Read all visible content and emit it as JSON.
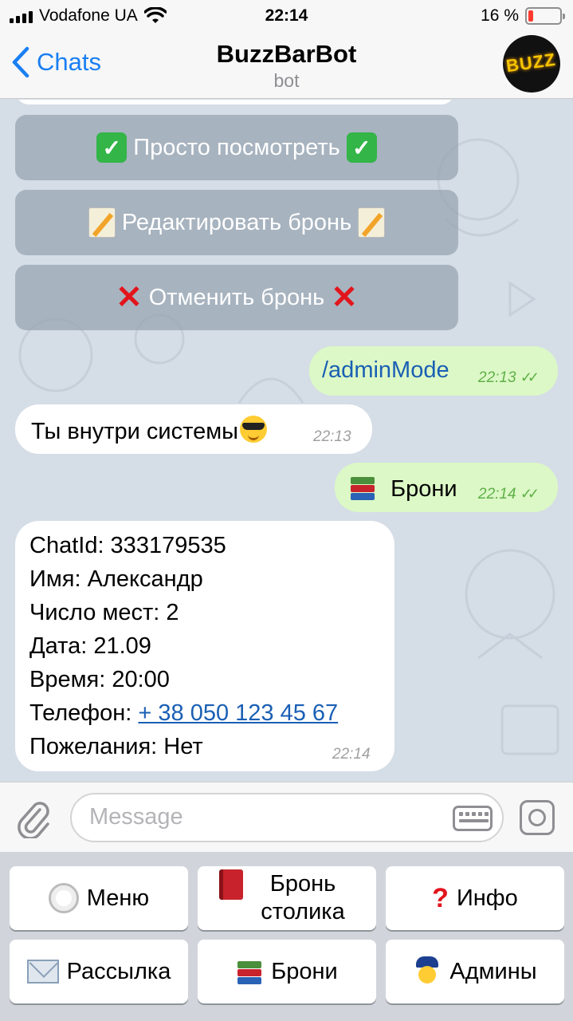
{
  "status_bar": {
    "carrier": "Vodafone UA",
    "time": "22:14",
    "battery": "16 %",
    "battery_level_fraction": 0.16
  },
  "nav": {
    "back_label": "Chats",
    "title": "BuzzBarBot",
    "subtitle": "bot",
    "avatar_text": "BUZZ"
  },
  "inline_buttons": [
    {
      "label": "Просто посмотреть",
      "icon": "check-mark-button-emoji"
    },
    {
      "label": "Редактировать бронь",
      "icon": "memo-emoji"
    },
    {
      "label": "Отменить бронь",
      "icon": "cross-mark-emoji"
    }
  ],
  "messages": [
    {
      "direction": "out",
      "text": "/adminMode",
      "time": "22:13",
      "status": "read"
    },
    {
      "direction": "in",
      "text": "Ты внутри системы",
      "emoji": "smiling-face-with-sunglasses",
      "time": "22:13"
    },
    {
      "direction": "out",
      "text": "Брони",
      "emoji": "books",
      "time": "22:14",
      "status": "read"
    },
    {
      "direction": "in",
      "time": "22:14",
      "lines": {
        "chat_id": "ChatId: 333179535",
        "name": "Имя: Александр",
        "seats": "Число мест: 2",
        "date": "Дата: 21.09",
        "time": "Время: 20:00",
        "phone_label": "Телефон: ",
        "phone_link": "+ 38 050 123 45 67",
        "wishes": "Пожелания: Нет"
      }
    }
  ],
  "input": {
    "placeholder": "Message"
  },
  "keyboard": [
    {
      "label": "Меню",
      "icon": "fork-knife-plate-emoji"
    },
    {
      "label": "Бронь столика",
      "icon": "red-book-emoji"
    },
    {
      "label": "Инфо",
      "icon": "question-mark-emoji"
    },
    {
      "label": "Рассылка",
      "icon": "incoming-envelope-emoji"
    },
    {
      "label": "Брони",
      "icon": "books-emoji"
    },
    {
      "label": "Админы",
      "icon": "police-officer-emoji"
    }
  ],
  "colors": {
    "accent": "#1a7ff3",
    "outgoing_bubble": "#dcf8c6",
    "incoming_bubble": "#ffffff",
    "read_check": "#5fb049",
    "link": "#1a5fb4"
  }
}
